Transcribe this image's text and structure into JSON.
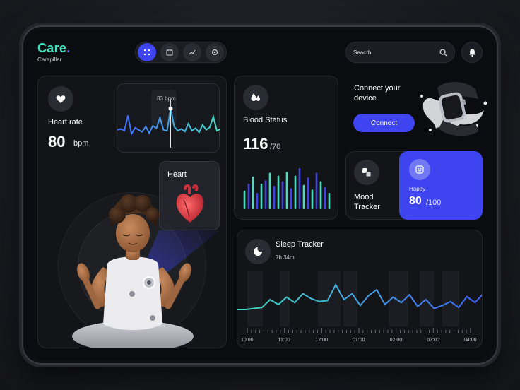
{
  "app": {
    "name": "Care",
    "subtitle": "Carepillar"
  },
  "nav": [
    {
      "icon": "grid-icon",
      "active": true
    },
    {
      "icon": "calendar-icon",
      "active": false
    },
    {
      "icon": "chart-icon",
      "active": false
    },
    {
      "icon": "settings-icon",
      "active": false
    }
  ],
  "search": {
    "value": "Seacrh"
  },
  "heart_rate": {
    "label": "Heart rate",
    "value": "80",
    "unit": "bpm",
    "tooltip": "83 bpm",
    "series": [
      40,
      42,
      38,
      75,
      30,
      45,
      40,
      35,
      48,
      32,
      50,
      44,
      70,
      40,
      38,
      92,
      48,
      38,
      42,
      36,
      55,
      38,
      44,
      34,
      52,
      40,
      46,
      72,
      38,
      42
    ]
  },
  "heart_panel": {
    "label": "Heart"
  },
  "blood": {
    "label": "Blood Status",
    "value": "116",
    "denominator": "/70",
    "bars": [
      40,
      55,
      70,
      35,
      55,
      62,
      78,
      50,
      72,
      60,
      80,
      45,
      72,
      88,
      52,
      68,
      42,
      78,
      60,
      48,
      35
    ]
  },
  "connect": {
    "title": "Connect your device",
    "button": "Connect"
  },
  "mood": {
    "label": "Mood Tracker",
    "state": "Happy",
    "value": "80",
    "denominator": "/100"
  },
  "sleep": {
    "label": "Sleep Tracker",
    "duration": "7h 34m",
    "times": [
      "10:00",
      "11:00",
      "12:00",
      "01:00",
      "02:00",
      "03:00",
      "04:00"
    ],
    "series": [
      20,
      20,
      22,
      24,
      40,
      30,
      45,
      34,
      52,
      42,
      36,
      38,
      70,
      40,
      52,
      28,
      48,
      60,
      30,
      45,
      34,
      50,
      26,
      40,
      22,
      28,
      36,
      24,
      46,
      34,
      52
    ]
  },
  "colors": {
    "accent": "#3d44f0",
    "teal": "#43e0c2",
    "blue": "#3f63ff"
  }
}
